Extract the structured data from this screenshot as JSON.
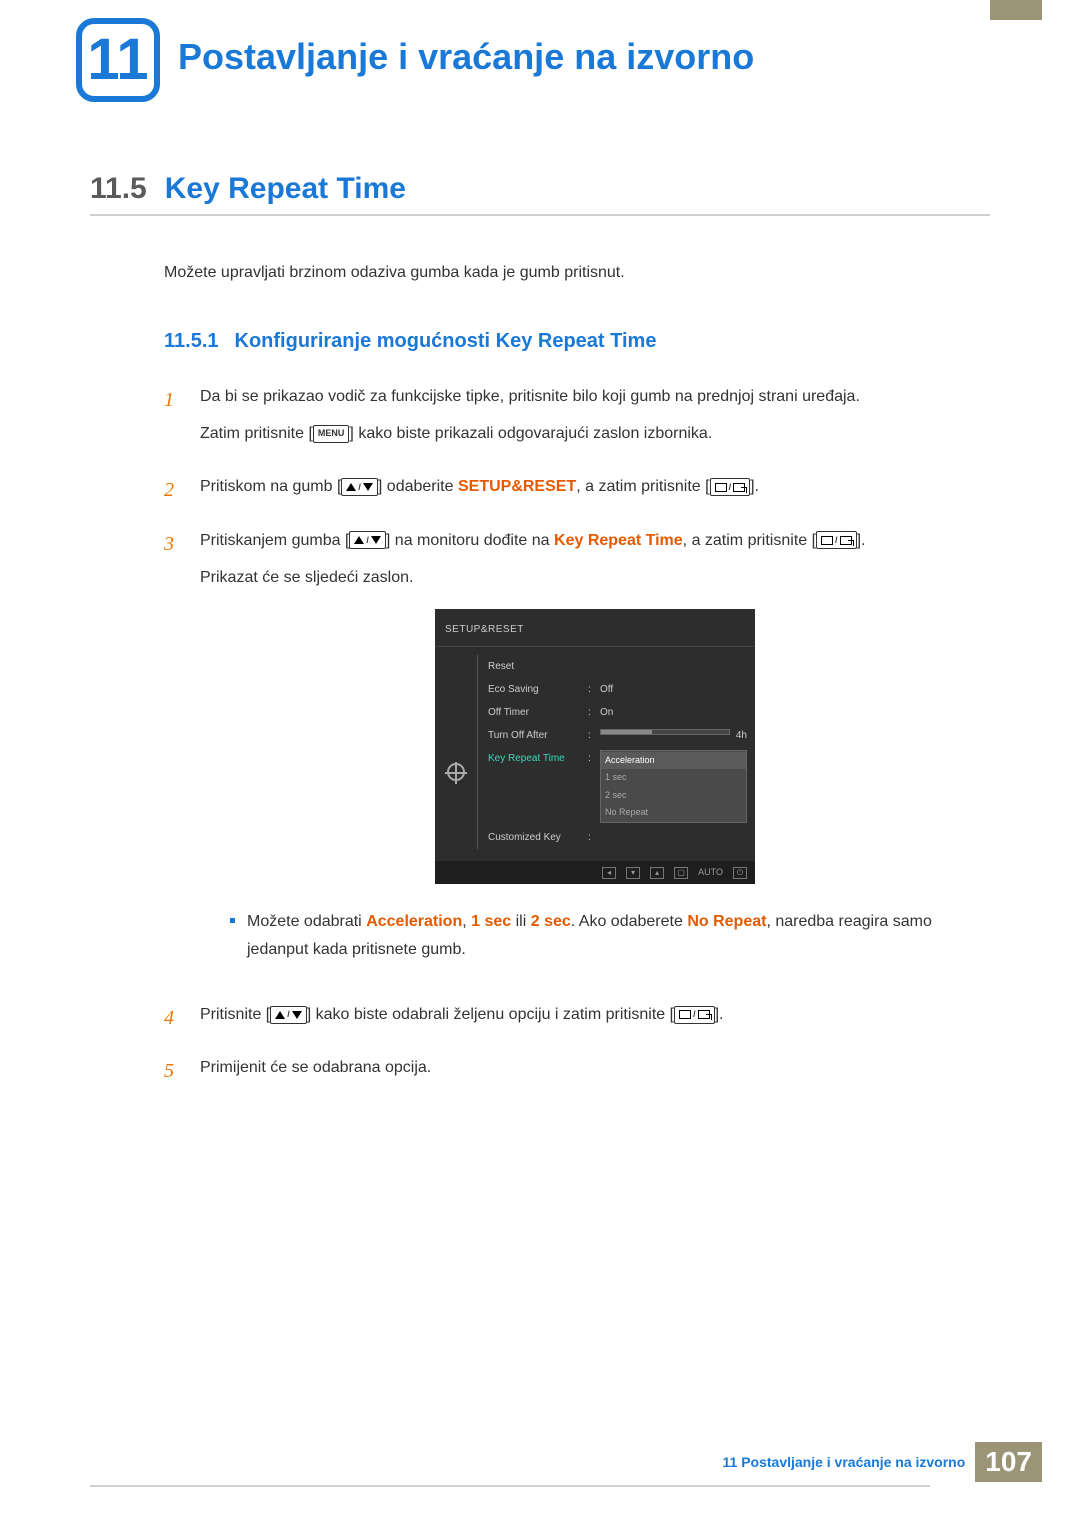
{
  "chapter": {
    "number": "11",
    "title": "Postavljanje i vraćanje na izvorno"
  },
  "section": {
    "number": "11.5",
    "title": "Key Repeat Time",
    "intro": "Možete upravljati brzinom odaziva gumba kada je gumb pritisnut."
  },
  "subsection": {
    "number": "11.5.1",
    "title": "Konfiguriranje mogućnosti Key Repeat Time"
  },
  "steps": {
    "s1a": "Da bi se prikazao vodič za funkcijske tipke, pritisnite bilo koji gumb na prednjoj strani uređaja.",
    "s1b_pre": "Zatim pritisnite [",
    "s1b_menu": "MENU",
    "s1b_post": "] kako biste prikazali odgovarajući zaslon izbornika.",
    "s2_pre": "Pritiskom na gumb [",
    "s2_mid": "] odaberite ",
    "s2_kw": "SETUP&RESET",
    "s2_post": ", a zatim pritisnite [",
    "s2_end": "].",
    "s3_pre": "Pritiskanjem gumba [",
    "s3_mid": "] na monitoru dođite na ",
    "s3_kw": "Key Repeat Time",
    "s3_post": ", a zatim pritisnite [",
    "s3_end": "].",
    "s3_extra": "Prikazat će se sljedeći zaslon.",
    "bullet_pre": "Možete odabrati ",
    "bullet_k1": "Acceleration",
    "bullet_c1": ", ",
    "bullet_k2": "1 sec",
    "bullet_c2": " ili ",
    "bullet_k3": "2 sec",
    "bullet_c3": ". Ako odaberete ",
    "bullet_k4": "No Repeat",
    "bullet_post": ", naredba reagira samo jedanput kada pritisnete gumb.",
    "s4_pre": "Pritisnite [",
    "s4_mid": "] kako biste odabrali željenu opciju i zatim pritisnite [",
    "s4_end": "].",
    "s5": "Primijenit će se odabrana opcija."
  },
  "osd": {
    "title": "SETUP&RESET",
    "items": {
      "reset": "Reset",
      "eco": "Eco Saving",
      "eco_val": "Off",
      "offTimer": "Off Timer",
      "offTimer_val": "On",
      "turnOff": "Turn Off After",
      "turnOff_val": "4h",
      "keyRepeat": "Key Repeat Time",
      "custKey": "Customized Key"
    },
    "dropdown": {
      "o1": "Acceleration",
      "o2": "1 sec",
      "o3": "2 sec",
      "o4": "No Repeat"
    },
    "footer_auto": "AUTO"
  },
  "footer": {
    "text": "11 Postavljanje i vraćanje na izvorno",
    "page": "107"
  }
}
